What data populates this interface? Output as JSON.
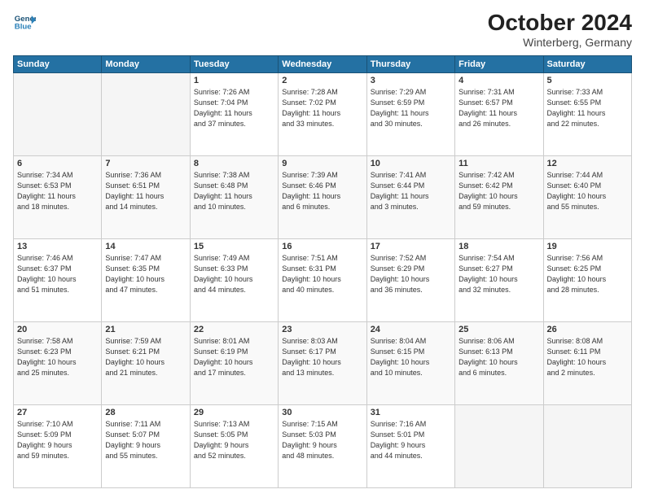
{
  "logo": {
    "line1": "General",
    "line2": "Blue"
  },
  "title": "October 2024",
  "subtitle": "Winterberg, Germany",
  "days_header": [
    "Sunday",
    "Monday",
    "Tuesday",
    "Wednesday",
    "Thursday",
    "Friday",
    "Saturday"
  ],
  "weeks": [
    [
      {
        "day": "",
        "info": ""
      },
      {
        "day": "",
        "info": ""
      },
      {
        "day": "1",
        "info": "Sunrise: 7:26 AM\nSunset: 7:04 PM\nDaylight: 11 hours\nand 37 minutes."
      },
      {
        "day": "2",
        "info": "Sunrise: 7:28 AM\nSunset: 7:02 PM\nDaylight: 11 hours\nand 33 minutes."
      },
      {
        "day": "3",
        "info": "Sunrise: 7:29 AM\nSunset: 6:59 PM\nDaylight: 11 hours\nand 30 minutes."
      },
      {
        "day": "4",
        "info": "Sunrise: 7:31 AM\nSunset: 6:57 PM\nDaylight: 11 hours\nand 26 minutes."
      },
      {
        "day": "5",
        "info": "Sunrise: 7:33 AM\nSunset: 6:55 PM\nDaylight: 11 hours\nand 22 minutes."
      }
    ],
    [
      {
        "day": "6",
        "info": "Sunrise: 7:34 AM\nSunset: 6:53 PM\nDaylight: 11 hours\nand 18 minutes."
      },
      {
        "day": "7",
        "info": "Sunrise: 7:36 AM\nSunset: 6:51 PM\nDaylight: 11 hours\nand 14 minutes."
      },
      {
        "day": "8",
        "info": "Sunrise: 7:38 AM\nSunset: 6:48 PM\nDaylight: 11 hours\nand 10 minutes."
      },
      {
        "day": "9",
        "info": "Sunrise: 7:39 AM\nSunset: 6:46 PM\nDaylight: 11 hours\nand 6 minutes."
      },
      {
        "day": "10",
        "info": "Sunrise: 7:41 AM\nSunset: 6:44 PM\nDaylight: 11 hours\nand 3 minutes."
      },
      {
        "day": "11",
        "info": "Sunrise: 7:42 AM\nSunset: 6:42 PM\nDaylight: 10 hours\nand 59 minutes."
      },
      {
        "day": "12",
        "info": "Sunrise: 7:44 AM\nSunset: 6:40 PM\nDaylight: 10 hours\nand 55 minutes."
      }
    ],
    [
      {
        "day": "13",
        "info": "Sunrise: 7:46 AM\nSunset: 6:37 PM\nDaylight: 10 hours\nand 51 minutes."
      },
      {
        "day": "14",
        "info": "Sunrise: 7:47 AM\nSunset: 6:35 PM\nDaylight: 10 hours\nand 47 minutes."
      },
      {
        "day": "15",
        "info": "Sunrise: 7:49 AM\nSunset: 6:33 PM\nDaylight: 10 hours\nand 44 minutes."
      },
      {
        "day": "16",
        "info": "Sunrise: 7:51 AM\nSunset: 6:31 PM\nDaylight: 10 hours\nand 40 minutes."
      },
      {
        "day": "17",
        "info": "Sunrise: 7:52 AM\nSunset: 6:29 PM\nDaylight: 10 hours\nand 36 minutes."
      },
      {
        "day": "18",
        "info": "Sunrise: 7:54 AM\nSunset: 6:27 PM\nDaylight: 10 hours\nand 32 minutes."
      },
      {
        "day": "19",
        "info": "Sunrise: 7:56 AM\nSunset: 6:25 PM\nDaylight: 10 hours\nand 28 minutes."
      }
    ],
    [
      {
        "day": "20",
        "info": "Sunrise: 7:58 AM\nSunset: 6:23 PM\nDaylight: 10 hours\nand 25 minutes."
      },
      {
        "day": "21",
        "info": "Sunrise: 7:59 AM\nSunset: 6:21 PM\nDaylight: 10 hours\nand 21 minutes."
      },
      {
        "day": "22",
        "info": "Sunrise: 8:01 AM\nSunset: 6:19 PM\nDaylight: 10 hours\nand 17 minutes."
      },
      {
        "day": "23",
        "info": "Sunrise: 8:03 AM\nSunset: 6:17 PM\nDaylight: 10 hours\nand 13 minutes."
      },
      {
        "day": "24",
        "info": "Sunrise: 8:04 AM\nSunset: 6:15 PM\nDaylight: 10 hours\nand 10 minutes."
      },
      {
        "day": "25",
        "info": "Sunrise: 8:06 AM\nSunset: 6:13 PM\nDaylight: 10 hours\nand 6 minutes."
      },
      {
        "day": "26",
        "info": "Sunrise: 8:08 AM\nSunset: 6:11 PM\nDaylight: 10 hours\nand 2 minutes."
      }
    ],
    [
      {
        "day": "27",
        "info": "Sunrise: 7:10 AM\nSunset: 5:09 PM\nDaylight: 9 hours\nand 59 minutes."
      },
      {
        "day": "28",
        "info": "Sunrise: 7:11 AM\nSunset: 5:07 PM\nDaylight: 9 hours\nand 55 minutes."
      },
      {
        "day": "29",
        "info": "Sunrise: 7:13 AM\nSunset: 5:05 PM\nDaylight: 9 hours\nand 52 minutes."
      },
      {
        "day": "30",
        "info": "Sunrise: 7:15 AM\nSunset: 5:03 PM\nDaylight: 9 hours\nand 48 minutes."
      },
      {
        "day": "31",
        "info": "Sunrise: 7:16 AM\nSunset: 5:01 PM\nDaylight: 9 hours\nand 44 minutes."
      },
      {
        "day": "",
        "info": ""
      },
      {
        "day": "",
        "info": ""
      }
    ]
  ]
}
